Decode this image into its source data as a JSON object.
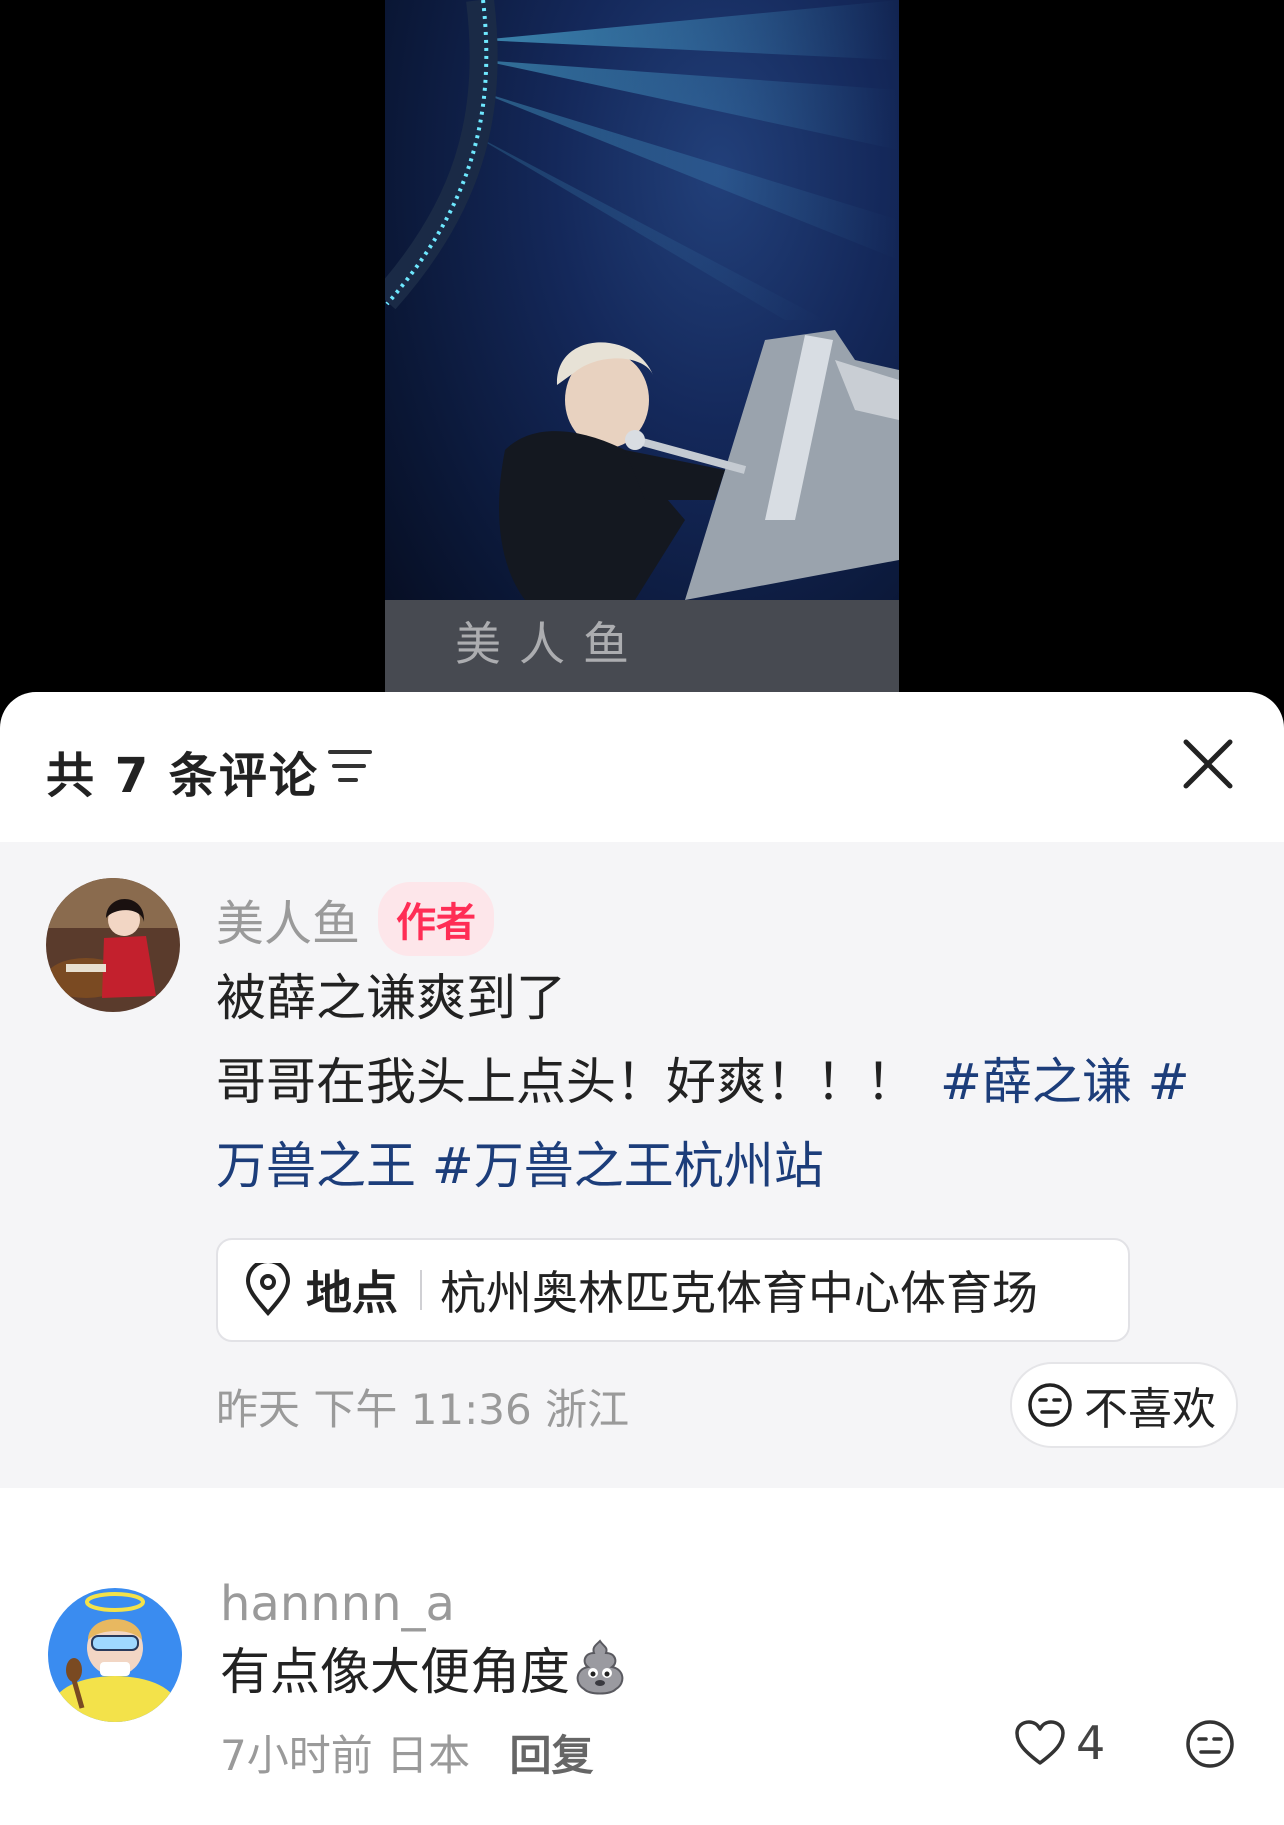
{
  "video": {
    "watermark": "美人鱼"
  },
  "comments_panel": {
    "title": "共 7 条评论",
    "sort_icon": "sort-lines-icon",
    "close_icon": "close-x-icon"
  },
  "comments": [
    {
      "username": "美人鱼",
      "badge": "作者",
      "line1": "被薛之谦爽到了",
      "line2_text": "哥哥在我头上点头！好爽！！！",
      "hashtag1": "#薛之谦",
      "hashtag2_start": " #",
      "hashtag2_rest": "万兽之王",
      "hashtag3": " #万兽之王杭州站",
      "location": {
        "label": "地点",
        "value": "杭州奥林匹克体育中心体育场"
      },
      "time": "昨天 下午 11:36 浙江",
      "dislike_label": "不喜欢"
    },
    {
      "username": "hannnn_a",
      "text": "有点像大便角度",
      "emoji": "poop-emoji",
      "time": "7小时前 日本",
      "reply_label": "回复",
      "likes": "4"
    }
  ],
  "colors": {
    "author_bg": "#f5f5f7",
    "badge_text": "#ff2d55",
    "badge_bg": "#fde6ea",
    "hashtag": "#1c3d7a",
    "muted": "#9a9a9a"
  }
}
